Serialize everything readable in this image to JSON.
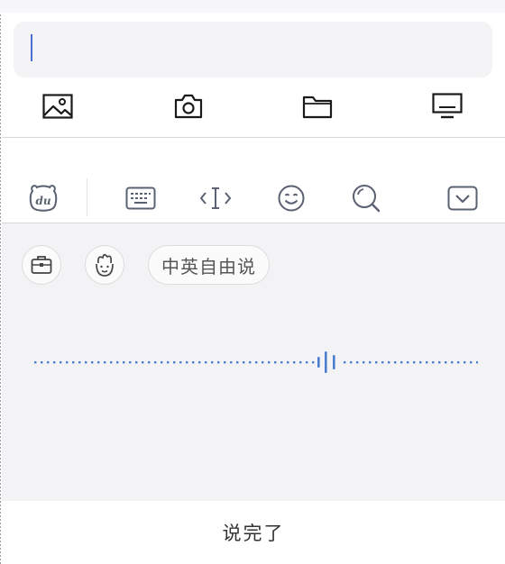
{
  "compose": {
    "input_value": ""
  },
  "attachments": {
    "items": [
      {
        "icon": "image-icon"
      },
      {
        "icon": "camera-icon"
      },
      {
        "icon": "folder-icon"
      },
      {
        "icon": "screen-icon"
      }
    ]
  },
  "keyboard_toolbar": {
    "items": [
      {
        "icon": "du-bear-logo-icon"
      },
      {
        "icon": "keyboard-icon"
      },
      {
        "icon": "cursor-move-icon"
      },
      {
        "icon": "emoji-icon"
      },
      {
        "icon": "search-icon"
      },
      {
        "icon": "collapse-keyboard-icon"
      }
    ]
  },
  "voice_panel": {
    "chips": [
      {
        "icon": "briefcase-icon"
      },
      {
        "icon": "dialect-avatar-icon"
      }
    ],
    "mode_label": "中英自由说"
  },
  "footer": {
    "done_label": "说完了"
  },
  "colors": {
    "accent": "#4a6fd1",
    "panel_bg": "#f3f3f6",
    "icon_stroke": "#1a1a1a",
    "toolbar_icon": "#5a6170"
  }
}
